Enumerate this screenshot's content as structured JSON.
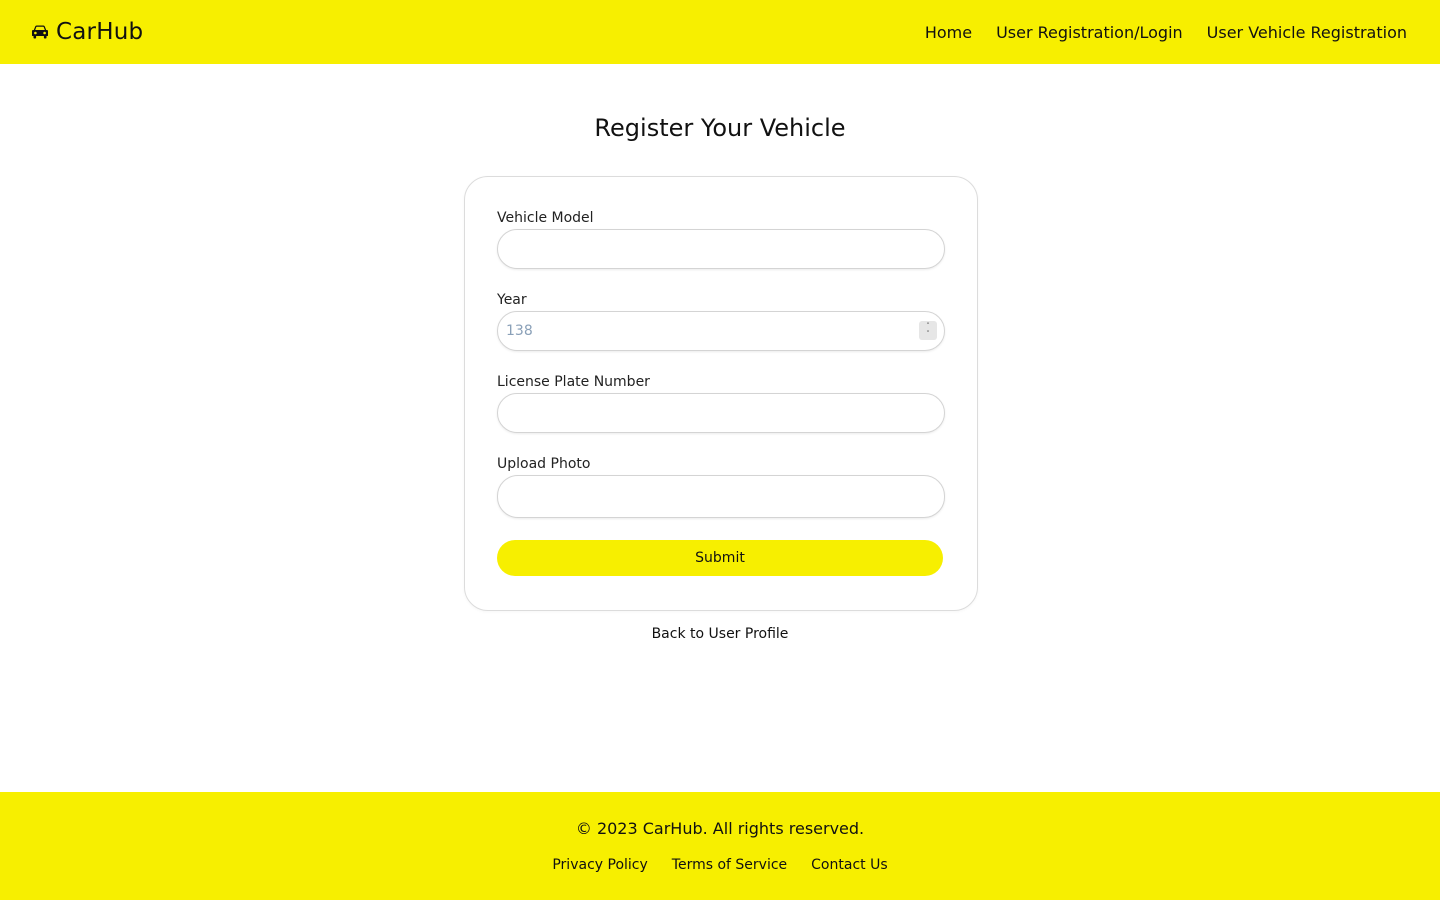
{
  "header": {
    "brand_icon": "car-icon",
    "brand_name": "CarHub",
    "nav": [
      {
        "label": "Home"
      },
      {
        "label": "User Registration/Login"
      },
      {
        "label": "User Vehicle Registration"
      }
    ]
  },
  "main": {
    "title": "Register Your Vehicle",
    "form": {
      "vehicle_model": {
        "label": "Vehicle Model",
        "value": "",
        "placeholder": ""
      },
      "year": {
        "label": "Year",
        "value": "",
        "placeholder": "138",
        "stepper_icon": "spinner-arrows-icon"
      },
      "license_plate": {
        "label": "License Plate Number",
        "value": "",
        "placeholder": ""
      },
      "upload_photo": {
        "label": "Upload Photo"
      },
      "submit_label": "Submit"
    },
    "back_link": "Back to User Profile"
  },
  "footer": {
    "copyright": "© 2023 CarHub. All rights reserved.",
    "links": [
      {
        "label": "Privacy Policy"
      },
      {
        "label": "Terms of Service"
      },
      {
        "label": "Contact Us"
      }
    ]
  },
  "colors": {
    "brand_yellow": "#f7ef00",
    "text": "#111111",
    "border": "#d4d4d4",
    "placeholder": "#8aa0b8"
  }
}
